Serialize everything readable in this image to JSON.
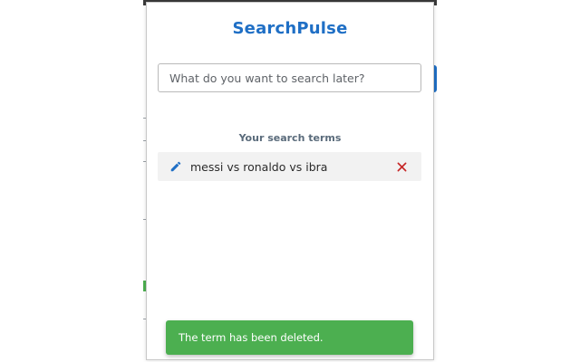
{
  "app": {
    "title": "SearchPulse"
  },
  "search": {
    "value": "",
    "placeholder": "What do you want to search later?"
  },
  "terms": {
    "heading": "Your search terms",
    "items": [
      {
        "label": "messi vs ronaldo vs ibra",
        "edit_icon": "pencil-icon",
        "delete_icon": "close-icon"
      }
    ]
  },
  "toast": {
    "message": "The term has been deleted."
  },
  "colors": {
    "accent": "#1f6fc5",
    "delete": "#c62828",
    "toast_bg": "#4caf50",
    "item_bg": "#f2f2f2"
  }
}
